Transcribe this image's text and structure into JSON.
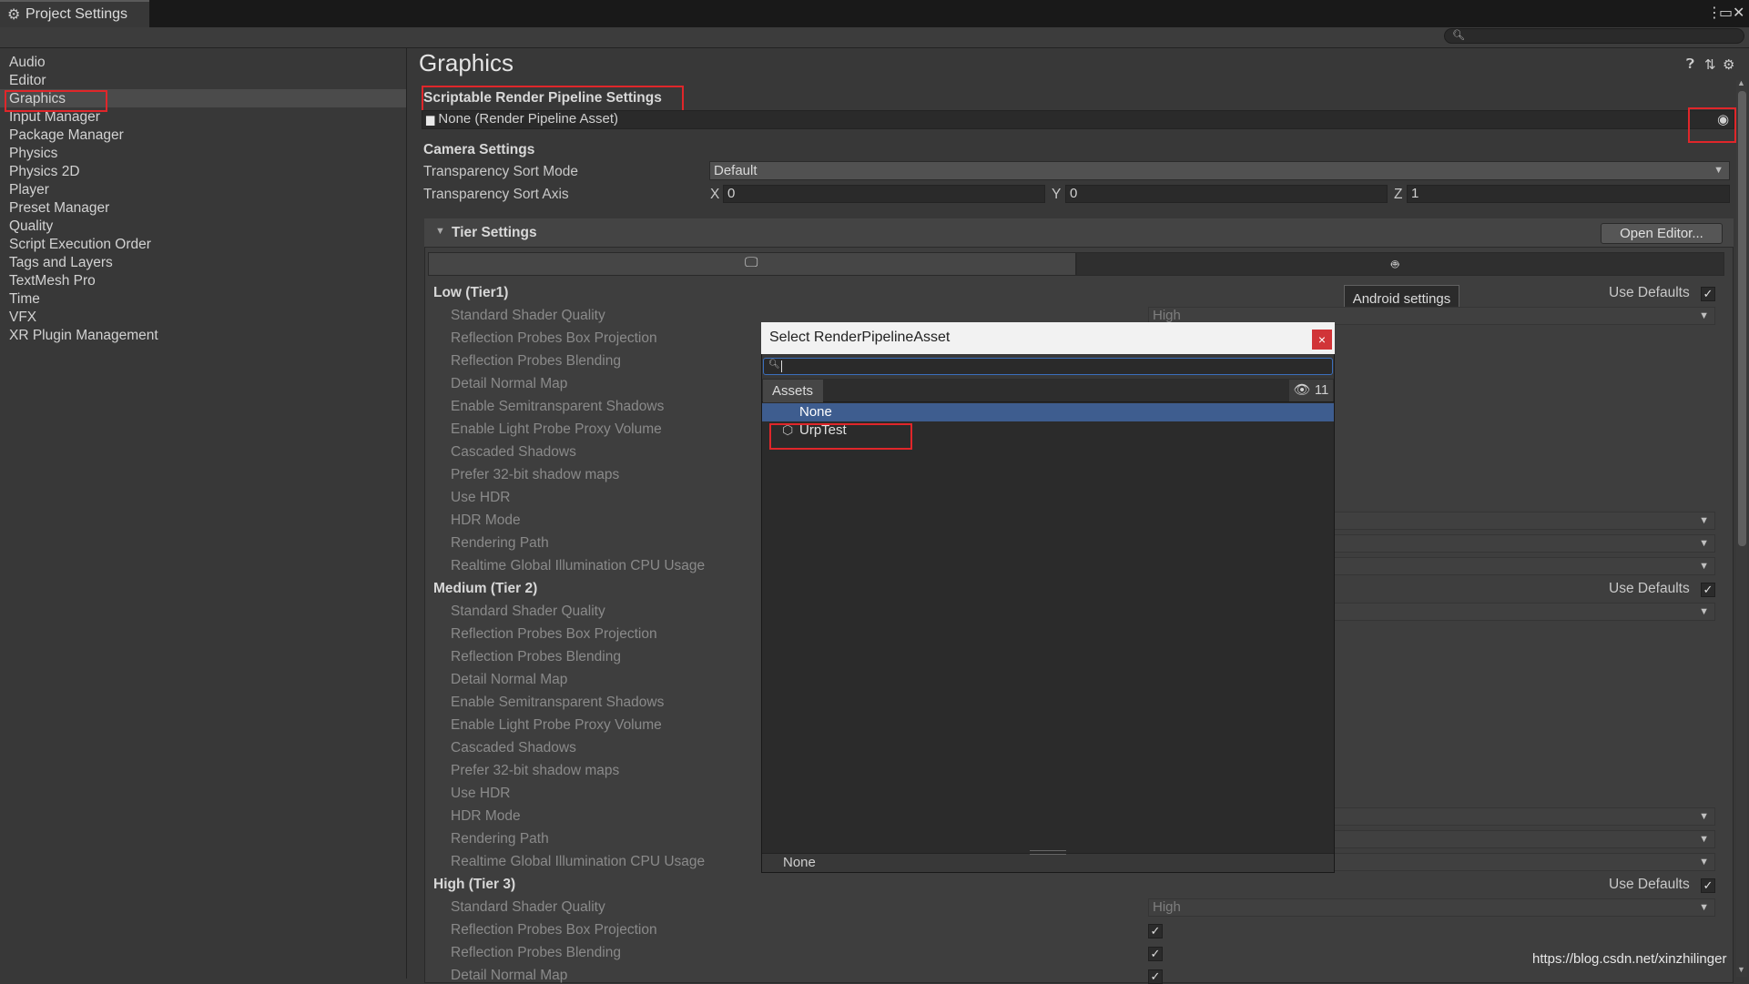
{
  "window": {
    "title": "Project Settings",
    "kebab": "⋮",
    "maximize": "▭",
    "close": "✕"
  },
  "search": {
    "placeholder": ""
  },
  "sidebar": {
    "items": [
      {
        "label": "Audio"
      },
      {
        "label": "Editor"
      },
      {
        "label": "Graphics"
      },
      {
        "label": "Input Manager"
      },
      {
        "label": "Package Manager"
      },
      {
        "label": "Physics"
      },
      {
        "label": "Physics 2D"
      },
      {
        "label": "Player"
      },
      {
        "label": "Preset Manager"
      },
      {
        "label": "Quality"
      },
      {
        "label": "Script Execution Order"
      },
      {
        "label": "Tags and Layers"
      },
      {
        "label": "TextMesh Pro"
      },
      {
        "label": "Time"
      },
      {
        "label": "VFX"
      },
      {
        "label": "XR Plugin Management"
      }
    ],
    "selected": "Graphics"
  },
  "main": {
    "title": "Graphics",
    "srp": {
      "heading": "Scriptable Render Pipeline Settings",
      "value": "None (Render Pipeline Asset)"
    },
    "camera": {
      "heading": "Camera Settings",
      "sort_mode_label": "Transparency Sort Mode",
      "sort_mode_value": "Default",
      "sort_axis_label": "Transparency Sort Axis",
      "x_label": "X",
      "x_value": "0",
      "y_label": "Y",
      "y_value": "0",
      "z_label": "Z",
      "z_value": "1"
    },
    "tier": {
      "heading": "Tier Settings",
      "open_editor": "Open Editor...",
      "tooltip": "Android settings",
      "use_defaults": "Use Defaults",
      "tiers": [
        {
          "name": "Low (Tier1)"
        },
        {
          "name": "Medium (Tier 2)"
        },
        {
          "name": "High (Tier 3)"
        }
      ],
      "settings": [
        "Standard Shader Quality",
        "Reflection Probes Box Projection",
        "Reflection Probes Blending",
        "Detail Normal Map",
        "Enable Semitransparent Shadows",
        "Enable Light Probe Proxy Volume",
        "Cascaded Shadows",
        "Prefer 32-bit shadow maps",
        "Use HDR",
        "HDR Mode",
        "Rendering Path",
        "Realtime Global Illumination CPU Usage"
      ],
      "shader_quality_value": "High"
    }
  },
  "dialog": {
    "title": "Select RenderPipelineAsset",
    "close": "×",
    "tab": "Assets",
    "count": "11",
    "items": [
      {
        "label": "None"
      },
      {
        "label": "UrpTest"
      }
    ],
    "footer": "None"
  },
  "watermark": "https://blog.csdn.net/xinzhilinger",
  "colors": {
    "accent_red": "#e0262a",
    "selection_blue": "#3e5d8f",
    "close_red": "#d13438"
  }
}
